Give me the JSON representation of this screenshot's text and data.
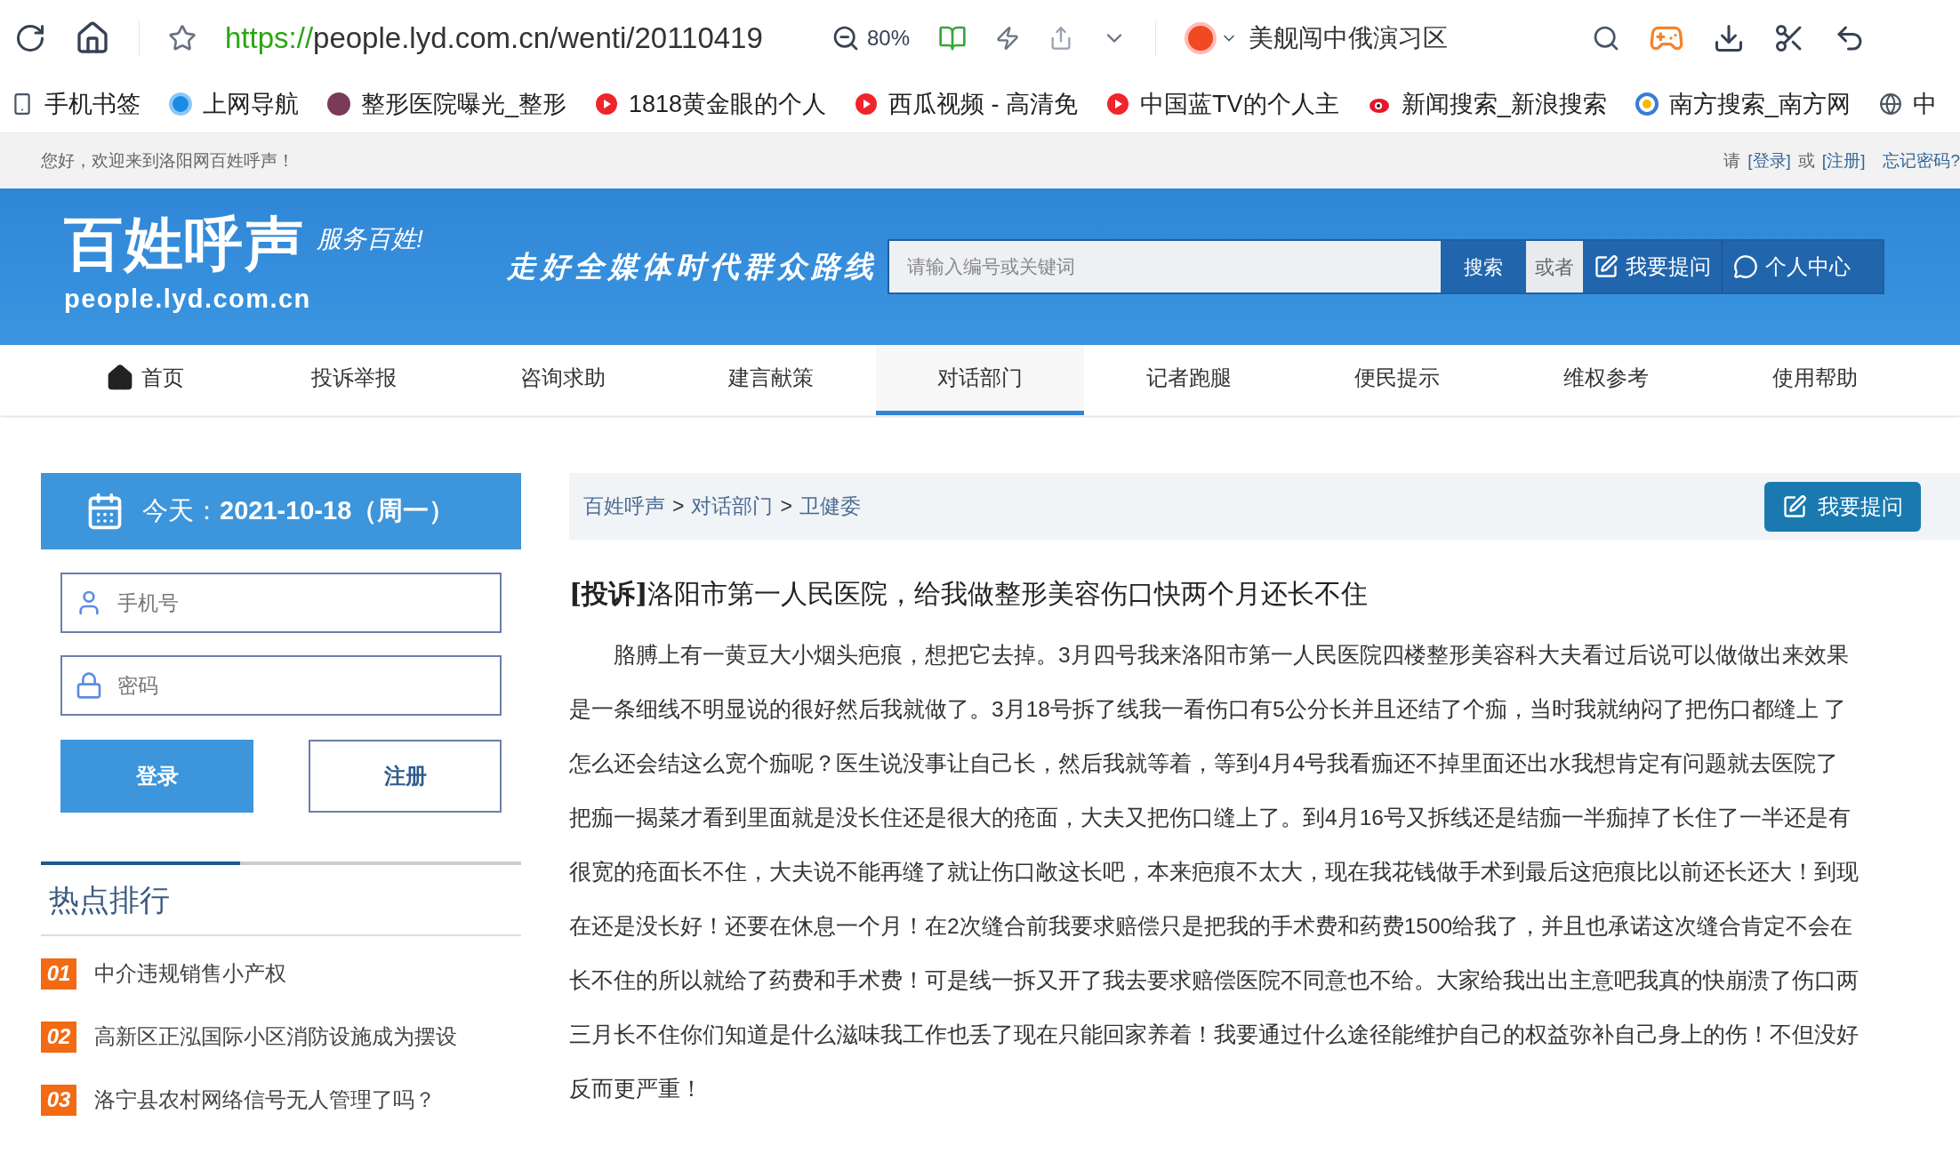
{
  "browser": {
    "url_scheme": "https://",
    "url_rest": "people.lyd.com.cn/wenti/20110419",
    "zoom": "80%",
    "search_query": "美舰闯中俄演习区"
  },
  "bookmarks": [
    "手机书签",
    "上网导航",
    "整形医院曝光_整形",
    "1818黄金眼的个人",
    "西瓜视频 - 高清免",
    "中国蓝TV的个人主",
    "新闻搜索_新浪搜索",
    "南方搜索_南方网",
    "中"
  ],
  "top_bar": {
    "welcome": "您好，欢迎来到洛阳网百姓呼声！",
    "please": "请",
    "login_link": "[登录]",
    "or": "或",
    "register_link": "[注册]",
    "forgot_link": "忘记密码?"
  },
  "header": {
    "logo": "百姓呼声",
    "logo_tagline": "服务百姓!",
    "logo_domain": "people.lyd.com.cn",
    "slogan": "走好全媒体时代群众路线",
    "search": {
      "placeholder": "请输入编号或关键词"
    },
    "search_button": "搜索",
    "or": "或者",
    "ask_button": "我要提问",
    "user_center": "个人中心"
  },
  "nav": [
    {
      "label": "首页",
      "selected": false
    },
    {
      "label": "投诉举报",
      "selected": false
    },
    {
      "label": "咨询求助",
      "selected": false
    },
    {
      "label": "建言献策",
      "selected": false
    },
    {
      "label": "对话部门",
      "selected": true
    },
    {
      "label": "记者跑腿",
      "selected": false
    },
    {
      "label": "便民提示",
      "selected": false
    },
    {
      "label": "维权参考",
      "selected": false
    },
    {
      "label": "使用帮助",
      "selected": false
    }
  ],
  "sidebar": {
    "today_label": "今天：",
    "today_date": "2021-10-18（周一）",
    "phone_field": {
      "placeholder": "手机号"
    },
    "password_field": {
      "placeholder": "密码"
    },
    "login_button": "登录",
    "register_button": "注册",
    "hot_title": "热点排行",
    "hot_items": [
      {
        "rank": "01",
        "title": "中介违规销售小产权"
      },
      {
        "rank": "02",
        "title": "高新区正泓国际小区消防设施成为摆设"
      },
      {
        "rank": "03",
        "title": "洛宁县农村网络信号无人管理了吗？"
      }
    ]
  },
  "breadcrumb": [
    "百姓呼声",
    "对话部门",
    "卫健委"
  ],
  "breadcrumb_sep": ">",
  "ask_button": "我要提问",
  "article": {
    "tag": "[投诉]",
    "title": "洛阳市第一人民医院，给我做整形美容伤口快两个月还长不住",
    "lines": [
      "　　胳膊上有一黄豆大小烟头疤痕，想把它去掉。3月四号我来洛阳市第一人民医院四楼整形美容科大夫看过后说可以做做出来效果",
      "是一条细线不明显说的很好然后我就做了。3月18号拆了线我一看伤口有5公分长并且还结了个痂，当时我就纳闷了把伤口都缝上 了",
      "怎么还会结这么宽个痂呢？医生说没事让自己长，然后我就等着，等到4月4号我看痂还不掉里面还出水我想肯定有问题就去医院了",
      "把痂一揭菜才看到里面就是没长住还是很大的疮面，大夫又把伤口缝上了。到4月16号又拆线还是结痂一半痂掉了长住了一半还是有",
      "很宽的疮面长不住，大夫说不能再缝了就让伤口敞这长吧，本来疤痕不太大，现在我花钱做手术到最后这疤痕比以前还长还大！到现",
      "在还是没长好！还要在休息一个月！在2次缝合前我要求赔偿只是把我的手术费和药费1500给我了，并且也承诺这次缝合肯定不会在",
      "长不住的所以就给了药费和手术费！可是线一拆又开了我去要求赔偿医院不同意也不给。大家给我出出主意吧我真的快崩溃了伤口两",
      "三月长不住你们知道是什么滋味我工作也丢了现在只能回家养着！我要通过什么途径能维护自己的权益弥补自己身上的伤！不但没好",
      "反而更严重！"
    ]
  }
}
